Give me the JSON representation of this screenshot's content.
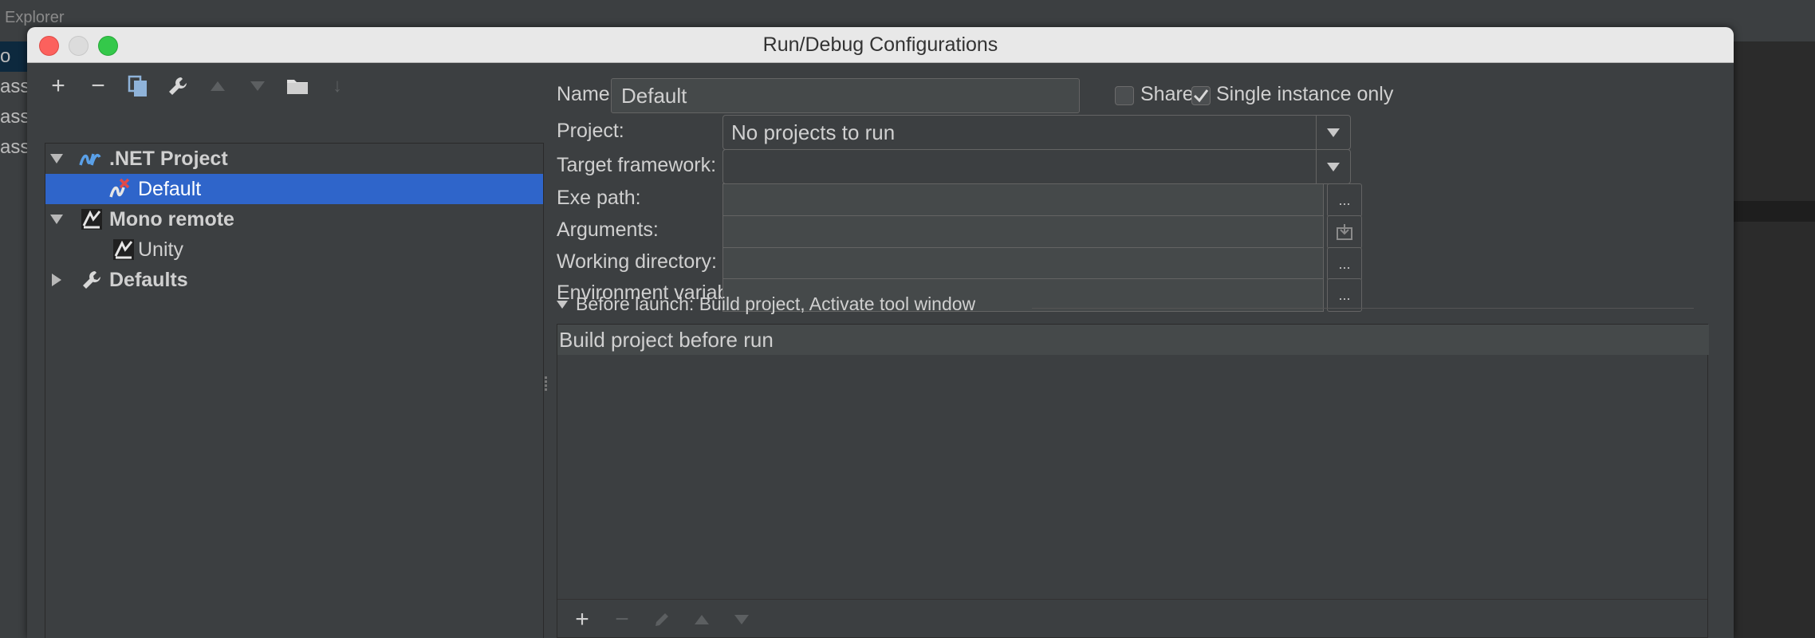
{
  "background": {
    "tab_label": "Explorer",
    "left_items": [
      "o",
      "ass",
      "ass",
      "ass"
    ]
  },
  "dialog": {
    "title": "Run/Debug Configurations",
    "toolbar": {
      "add": "+",
      "remove": "−",
      "sort": "↓"
    },
    "tree": [
      {
        "label": ".NET Project",
        "expanded": true,
        "bold": true,
        "icon": "dotnet-icon"
      },
      {
        "label": "Default",
        "selected": true,
        "icon": "dotnet-config-error-icon"
      },
      {
        "label": "Mono remote",
        "expanded": true,
        "bold": true,
        "icon": "mono-remote-icon"
      },
      {
        "label": "Unity",
        "icon": "mono-remote-icon"
      },
      {
        "label": "Defaults",
        "expanded": false,
        "bold": true,
        "icon": "wrench-icon"
      }
    ],
    "form": {
      "name_label": "Name:",
      "name_value": "Default",
      "share_label": "Share",
      "share_checked": false,
      "single_instance_label": "Single instance only",
      "single_instance_checked": true,
      "project_label": "Project:",
      "project_value": "No projects to run",
      "target_framework_label": "Target framework:",
      "target_framework_value": "",
      "exe_path_label": "Exe path:",
      "arguments_label": "Arguments:",
      "working_directory_label": "Working directory:",
      "env_vars_label": "Environment variables:",
      "browse_label": "..."
    },
    "before_launch": {
      "header": "Before launch: Build project, Activate tool window",
      "items": [
        "Build project before run"
      ],
      "add": "+",
      "remove": "−"
    }
  }
}
